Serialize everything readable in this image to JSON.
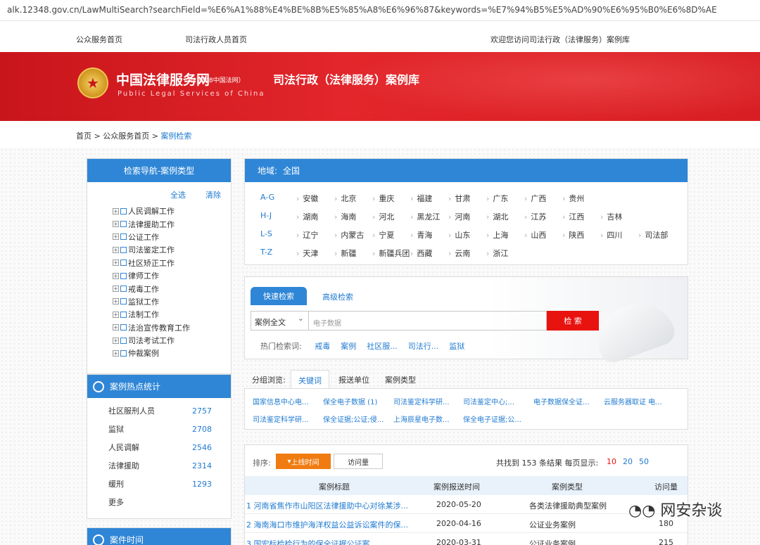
{
  "url": "alk.12348.gov.cn/LawMultiSearch?searchField=%E6%A1%88%E4%BE%8B%E5%85%A8%E6%96%87&keywords=%E7%94%B5%E5%AD%90%E6%95%B0%E6%8D%AE",
  "topnav": {
    "home": "公众服务首页",
    "staff": "司法行政人员首页",
    "welcome": "欢迎您访问司法行政（法律服务）案例库"
  },
  "banner": {
    "title": "中国法律服务网",
    "sub": "（12348中国法网）",
    "en": "Public Legal Services of China",
    "db": "司法行政（法律服务）案例库"
  },
  "breadcrumb": {
    "a": "首页",
    "sep": ">",
    "b": "公众服务首页",
    "c": "案例检索"
  },
  "nav": {
    "title": "检索导航-案例类型",
    "select_all": "全选",
    "clear": "清除",
    "items": [
      "人民调解工作",
      "法律援助工作",
      "公证工作",
      "司法鉴定工作",
      "社区矫正工作",
      "律师工作",
      "戒毒工作",
      "监狱工作",
      "法制工作",
      "法治宣传教育工作",
      "司法考试工作",
      "仲裁案例"
    ]
  },
  "stats": {
    "title": "案例热点统计",
    "rows": [
      {
        "label": "社区服刑人员",
        "count": "2757"
      },
      {
        "label": "监狱",
        "count": "2708"
      },
      {
        "label": "人民调解",
        "count": "2546"
      },
      {
        "label": "法律援助",
        "count": "2314"
      },
      {
        "label": "缓刑",
        "count": "1293"
      }
    ],
    "more": "更多"
  },
  "time_panel": {
    "title": "案件时间"
  },
  "region": {
    "label": "地域:",
    "all": "全国",
    "rows": [
      {
        "letter": "A-G",
        "items": [
          "安徽",
          "北京",
          "重庆",
          "福建",
          "甘肃",
          "广东",
          "广西",
          "贵州"
        ]
      },
      {
        "letter": "H-J",
        "items": [
          "湖南",
          "海南",
          "河北",
          "黑龙江",
          "河南",
          "湖北",
          "江苏",
          "江西",
          "吉林"
        ]
      },
      {
        "letter": "L-S",
        "items": [
          "辽宁",
          "内蒙古",
          "宁夏",
          "青海",
          "山东",
          "上海",
          "山西",
          "陕西",
          "四川",
          "司法部"
        ]
      },
      {
        "letter": "T-Z",
        "items": [
          "天津",
          "新疆",
          "新疆兵团",
          "西藏",
          "云南",
          "浙江"
        ]
      }
    ]
  },
  "search": {
    "quick_tab": "快速检索",
    "adv_tab": "高级检索",
    "field": "案例全文",
    "query": "电子数据",
    "button": "检 索",
    "hot_label": "热门检索词:",
    "hot": [
      "戒毒",
      "案例",
      "社区服...",
      "司法行...",
      "监狱"
    ]
  },
  "group": {
    "label": "分组浏览:",
    "tabs": [
      "关键词",
      "报送单位",
      "案例类型"
    ],
    "keywords": [
      [
        "国家信息中心电...",
        "保全电子数据 (1)",
        "司法鉴定科学研...",
        "司法鉴定中心;...",
        "电子数据保全证...",
        "云服务器取证 电..."
      ],
      [
        "司法鉴定科学研...",
        "保全证据;公证;侵...",
        "上海辰星电子数...",
        "保全电子证据;公..."
      ]
    ]
  },
  "results": {
    "sort_label": "排序:",
    "sort_active": "上线时间",
    "sort_other": "访问量",
    "total_text": "共找到 153 条结果  每页显示:",
    "page_sizes": [
      "10",
      "20",
      "50"
    ],
    "headers": [
      "案例标题",
      "案例报送时间",
      "案例类型",
      "访问量"
    ],
    "rows": [
      {
        "title": "1 河南省焦作市山阳区法律援助中心对徐某涉...",
        "date": "2020-05-20",
        "type": "各类法律援助典型案例",
        "views": ""
      },
      {
        "title": "2 海南海口市维护海洋权益公益诉讼案件的保...",
        "date": "2020-04-16",
        "type": "公证业务案例",
        "views": "180"
      },
      {
        "title": "3 国宏标检检行为的保全证据公证案",
        "date": "2020-03-31",
        "type": "公证业务案例",
        "views": "215"
      }
    ]
  },
  "watermark": "网安杂谈",
  "colors": {
    "brand_red": "#d81e23",
    "blue": "#2f86d6",
    "link": "#1f7ad0",
    "orange": "#f07b10",
    "search_btn": "#e8120f"
  }
}
